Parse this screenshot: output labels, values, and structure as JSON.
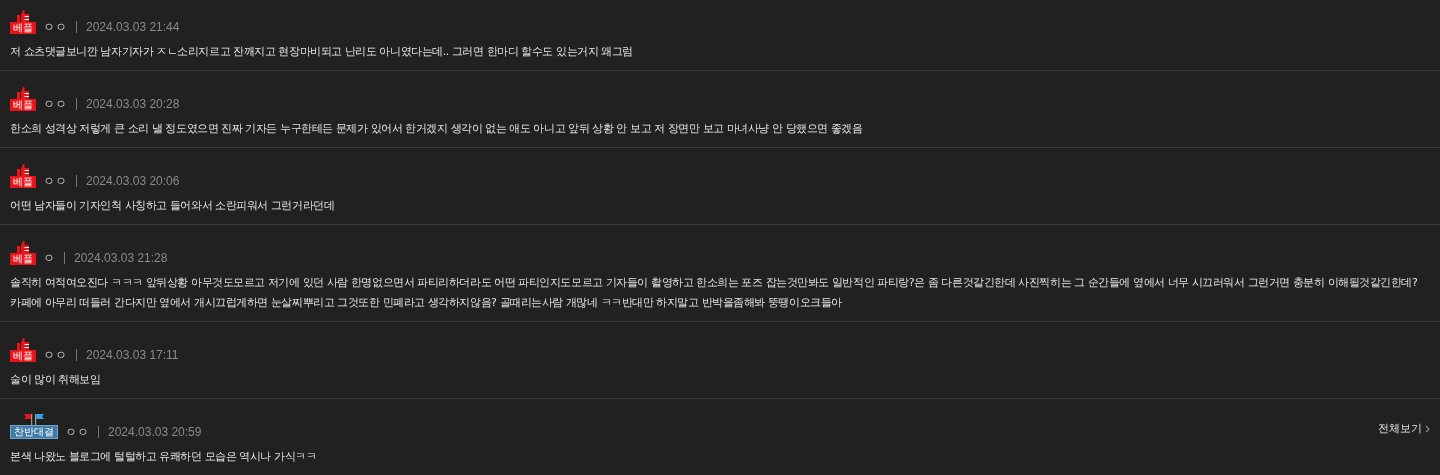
{
  "comments": [
    {
      "badge": {
        "kind": "best",
        "label": "베플"
      },
      "author": "ㅇㅇ",
      "date": "2024.03.03 21:44",
      "text": "저 쇼츠댓글보니깐 남자기자가 ㅈㄴ소리지르고 잔깨지고 현장마비되고 난리도 아니였다는데.. 그러면 한마디 할수도 있는거지 왜그럼"
    },
    {
      "badge": {
        "kind": "best",
        "label": "베플"
      },
      "author": "ㅇㅇ",
      "date": "2024.03.03 20:28",
      "text": "한소희 성격상 저렇게 큰 소리 낼 정도였으면 진짜 기자든 누구한테든 문제가 있어서 한거겠지 생각이 없는 애도 아니고 앞뒤 상황 안 보고 저 장면만 보고 마녀사냥 안 당했으면 좋겠음"
    },
    {
      "badge": {
        "kind": "best",
        "label": "베플"
      },
      "author": "ㅇㅇ",
      "date": "2024.03.03 20:06",
      "text": "어떤 남자들이 기자인척 사칭하고 들어와서 소란피워서 그런거라던데"
    },
    {
      "badge": {
        "kind": "best",
        "label": "베플"
      },
      "author": "ㅇ",
      "date": "2024.03.03 21:28",
      "text": "솔직히 여적여오진다 ㅋㅋㅋ 앞뒤상황 아무것도모르고 저기에 있던 사람 한명없으면서 파티리하더라도 어떤 파티인지도모르고 기자들이 촬영하고 한소희는 포즈 잡는것만봐도 일반적인 파티랑?은 좀 다른것같긴한데 사진찍히는 그 순간들에 옆에서 너무 시끄러워서 그런거면 충분히 이해될것같긴한데? 카페에 아무리 떠들러 간다지만 옆에서 개시끄럽게하면 눈살찌뿌리고 그것또한 민폐라고 생각하지않음? 골때리는사람 개많네 ㅋㅋ반대만 하지말고 반박을좀해봐 뚱땡이오크들아"
    },
    {
      "badge": {
        "kind": "best",
        "label": "베플"
      },
      "author": "ㅇㅇ",
      "date": "2024.03.03 17:11",
      "text": "술이 많이 취해보임"
    },
    {
      "badge": {
        "kind": "versus",
        "label": "찬반대결"
      },
      "author": "ㅇㅇ",
      "date": "2024.03.03 20:59",
      "text": "본색 나왔노 블로그에 털털하고 유쾌하던 모습은 역시나 가식ㅋㅋ",
      "more_link": "전체보기"
    }
  ]
}
